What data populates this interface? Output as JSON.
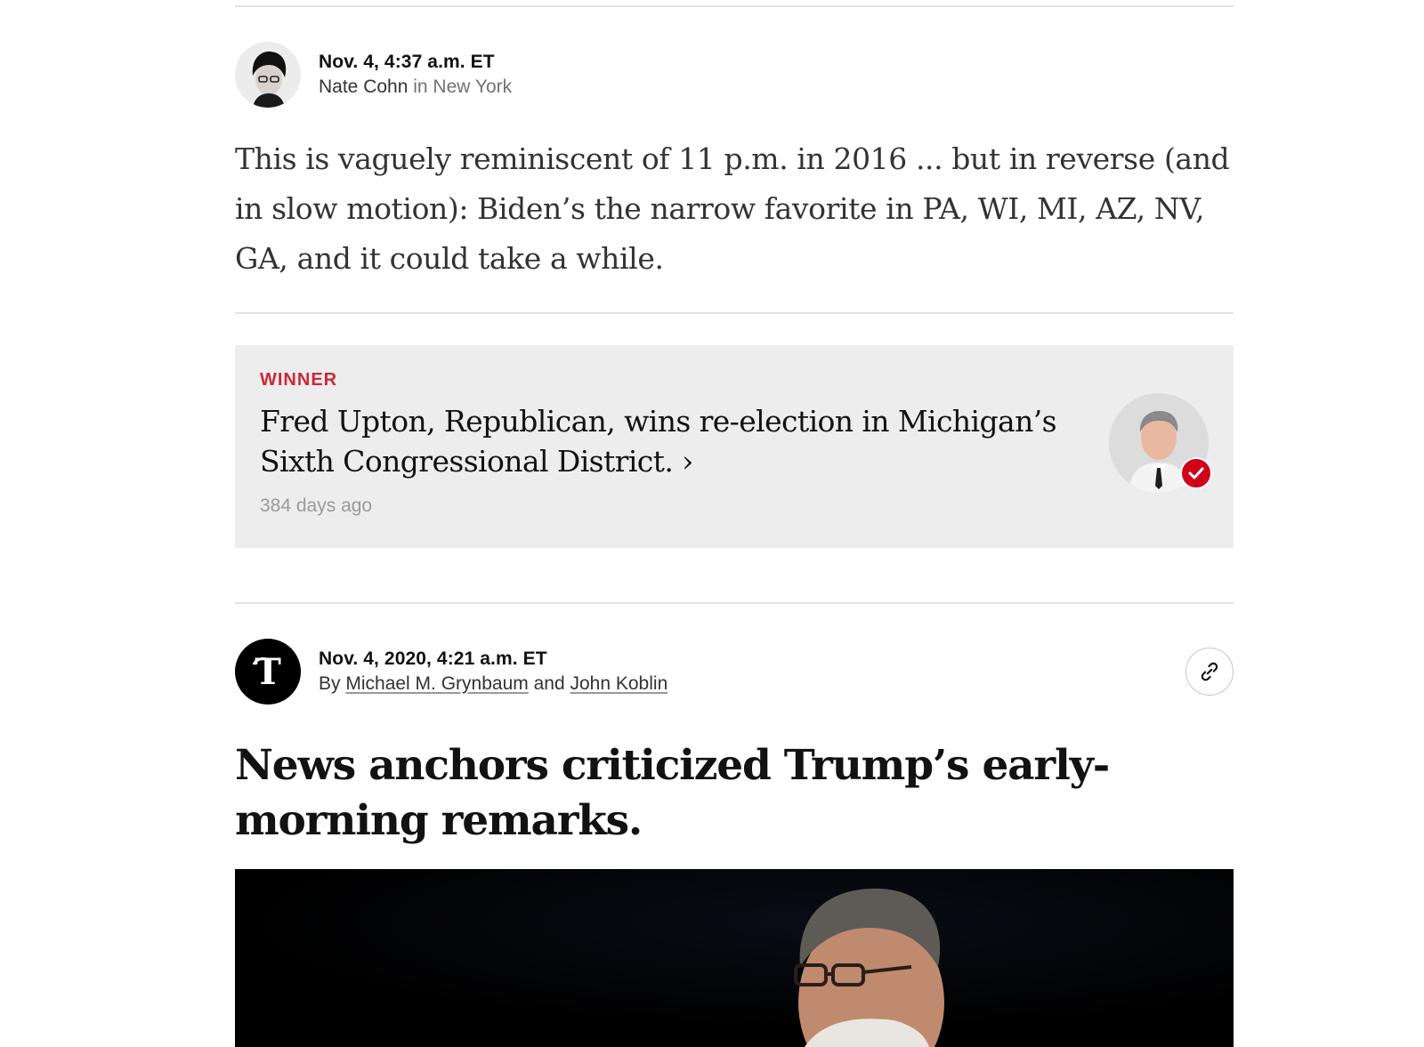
{
  "post1": {
    "timestamp": "Nov. 4, 4:37 a.m. ET",
    "author": "Nate Cohn",
    "location": "in New York",
    "text": "This is vaguely reminiscent of 11 p.m. in 2016 ... but in reverse (and in slow motion): Biden’s the narrow favorite in PA, WI, MI, AZ, NV, GA, and it could take a while."
  },
  "winner_card": {
    "label": "WINNER",
    "headline": "Fred Upton, Republican, wins re-election in Michigan’s Sixth Congressional District. ›",
    "time_ago": "384 days ago",
    "badge_color": "#d0021b"
  },
  "post2": {
    "timestamp": "Nov. 4, 2020, 4:21 a.m. ET",
    "by": "By",
    "author1": "Michael M. Grynbaum",
    "conjunction": "and",
    "author2": "John Koblin",
    "headline": "News anchors criticized Trump’s early-morning remarks.",
    "link_icon": "link-icon"
  },
  "colors": {
    "accent_red": "#cc2936",
    "card_bg": "#ededed",
    "rule": "#e2e2e2"
  }
}
